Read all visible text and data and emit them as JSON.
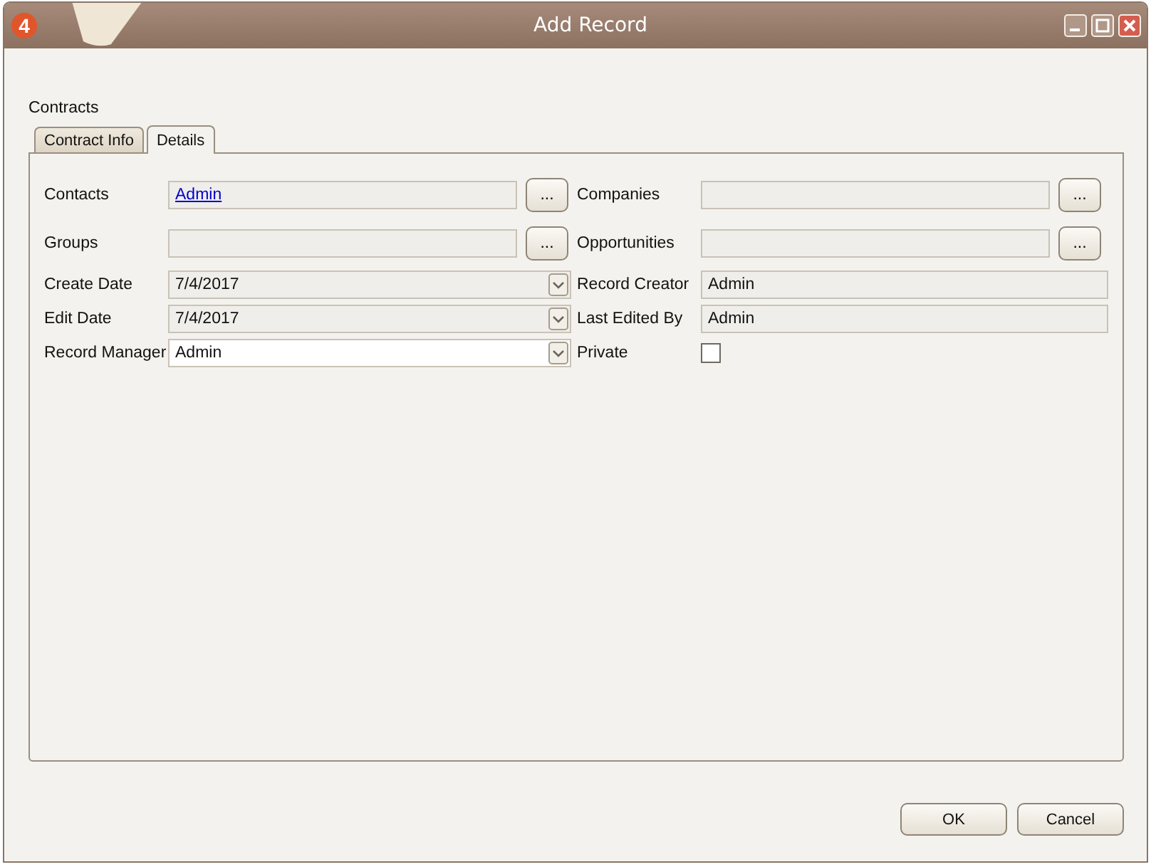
{
  "window": {
    "title": "Add Record",
    "app_badge": "4"
  },
  "section_label": "Contracts",
  "tabs": [
    {
      "label": "Contract Info",
      "selected": false
    },
    {
      "label": "Details",
      "selected": true
    }
  ],
  "rows": [
    {
      "left": {
        "label": "Contacts",
        "kind": "lookup",
        "value": "Admin",
        "button": "..."
      },
      "right": {
        "label": "Companies",
        "kind": "lookup",
        "button": "..."
      }
    },
    {
      "left": {
        "label": "Groups",
        "kind": "lookup",
        "button": "..."
      },
      "right": {
        "label": "Opportunities",
        "kind": "lookup",
        "button": "..."
      }
    },
    {
      "left": {
        "label": "Create Date",
        "kind": "dropdown",
        "value": "7/4/2017",
        "disabled": true
      },
      "right": {
        "label": "Record Creator",
        "kind": "readonly",
        "value": "Admin"
      }
    },
    {
      "left": {
        "label": "Edit Date",
        "kind": "dropdown",
        "value": "7/4/2017",
        "disabled": true
      },
      "right": {
        "label": "Last Edited By",
        "kind": "readonly",
        "value": "Admin"
      }
    },
    {
      "left": {
        "label": "Record Manager",
        "kind": "dropdown",
        "value": "Admin",
        "disabled": false
      },
      "right": {
        "label": "Private",
        "kind": "checkbox",
        "checked": false
      }
    }
  ],
  "buttons": [
    "OK",
    "Cancel"
  ]
}
